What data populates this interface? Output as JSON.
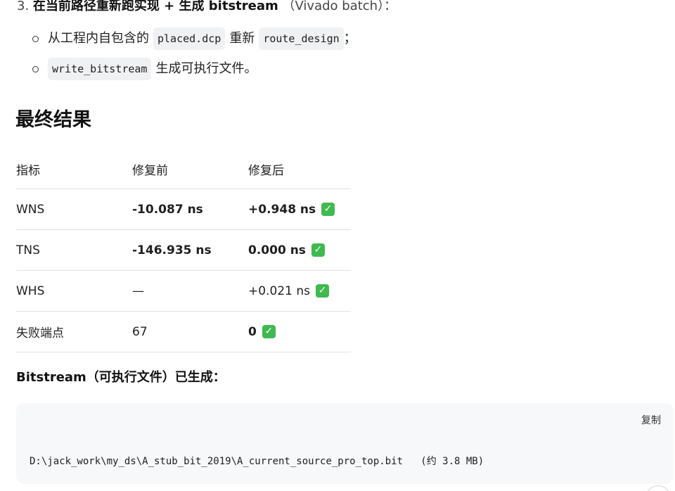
{
  "step": {
    "number": "3.",
    "bold": "在当前路径重新跑实现 + 生成 bitstream",
    "light": "（Vivado batch）："
  },
  "bullets": [
    {
      "pre": "从工程内自包含的",
      "code1": "placed.dcp",
      "mid": "重新",
      "code2": "route_design",
      "post": "；"
    },
    {
      "code1": "write_bitstream",
      "post": "生成可执行文件。"
    }
  ],
  "heading": "最终结果",
  "table": {
    "headers": [
      "指标",
      "修复前",
      "修复后"
    ],
    "rows": [
      {
        "metric": "WNS",
        "before": "-10.087 ns",
        "after": "+0.948 ns",
        "before_bold": true,
        "after_bold": true
      },
      {
        "metric": "TNS",
        "before": "-146.935 ns",
        "after": "0.000 ns",
        "before_bold": true,
        "after_bold": true
      },
      {
        "metric": "WHS",
        "before": "—",
        "after": "+0.021 ns",
        "before_bold": false,
        "after_bold": false
      },
      {
        "metric": "失败端点",
        "before": "67",
        "after": "0",
        "before_bold": false,
        "after_bold": true
      }
    ],
    "check_icon": "check-mark-icon",
    "check_color": "#3fb950"
  },
  "bitstream_label": "Bitstream（可执行文件）已生成：",
  "codeblock": {
    "copy_label": "复制",
    "line": "D:\\jack_work\\my_ds\\A_stub_bit_2019\\A_current_source_pro_top.bit   (约 3.8 MB)"
  }
}
